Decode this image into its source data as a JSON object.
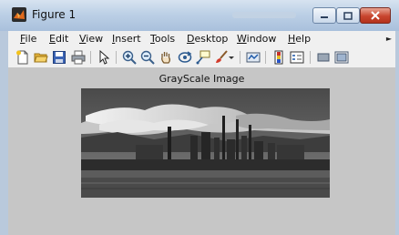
{
  "window": {
    "title": "Figure 1"
  },
  "menu": [
    {
      "key": "file",
      "u": "F",
      "rest": "ile"
    },
    {
      "key": "edit",
      "u": "E",
      "rest": "dit"
    },
    {
      "key": "view",
      "u": "V",
      "rest": "iew"
    },
    {
      "key": "insert",
      "u": "I",
      "rest": "nsert"
    },
    {
      "key": "tools",
      "u": "T",
      "rest": "ools"
    },
    {
      "key": "desktop",
      "u": "D",
      "rest": "esktop"
    },
    {
      "key": "window",
      "u": "W",
      "rest": "indow"
    },
    {
      "key": "help",
      "u": "H",
      "rest": "elp"
    }
  ],
  "toolbar_icons": [
    "new-figure-icon",
    "open-folder-icon",
    "save-icon",
    "print-icon",
    "pointer-icon",
    "zoom-in-icon",
    "zoom-out-icon",
    "pan-hand-icon",
    "rotate-3d-icon",
    "data-cursor-icon",
    "brush-icon",
    "brush-dropdown-icon",
    "link-plot-icon",
    "insert-colorbar-icon",
    "insert-legend-icon",
    "hide-plot-tools-icon",
    "show-plot-tools-icon"
  ],
  "figure": {
    "title": "GrayScale Image"
  }
}
